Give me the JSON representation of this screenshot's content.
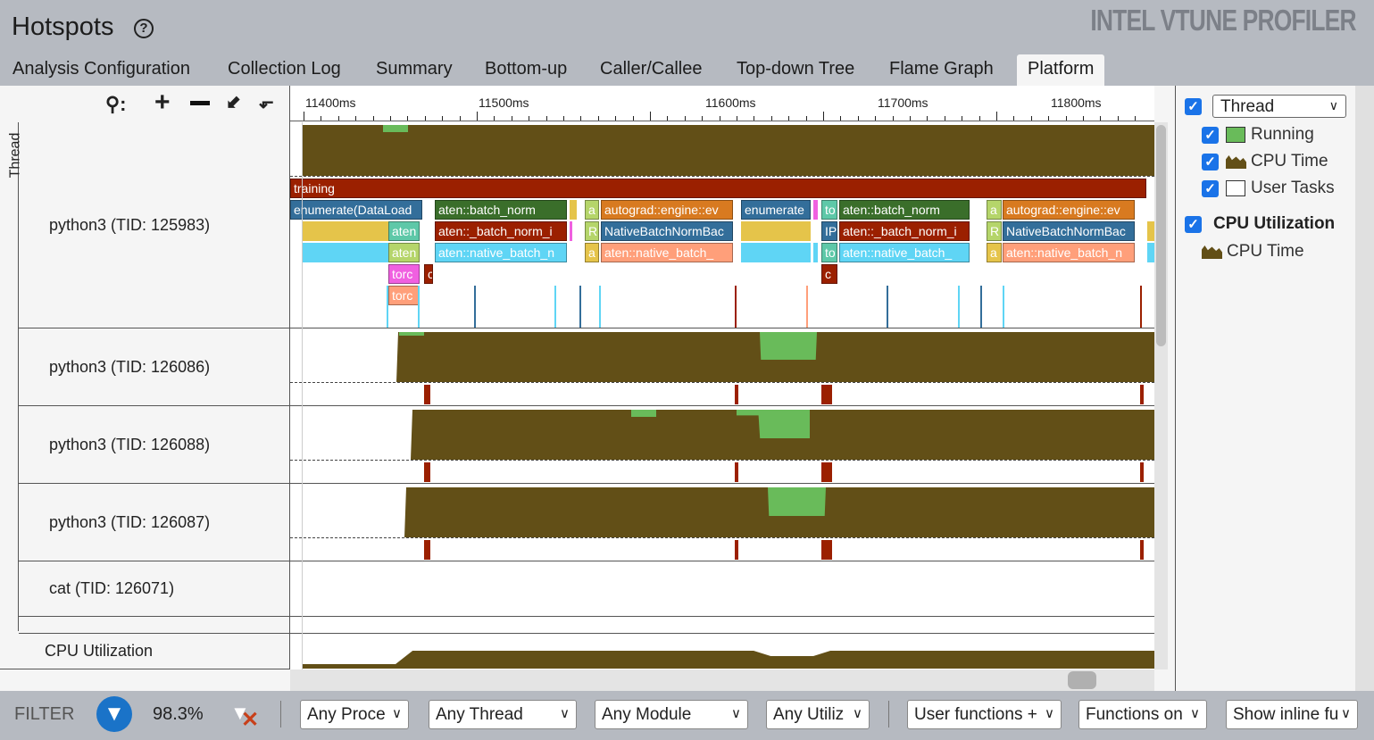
{
  "header": {
    "title": "Hotspots",
    "help_icon": "question-circle-icon",
    "brand": "INTEL VTUNE PROFILER"
  },
  "tabs": [
    {
      "label": "Analysis Configuration"
    },
    {
      "label": "Collection Log"
    },
    {
      "label": "Summary"
    },
    {
      "label": "Bottom-up"
    },
    {
      "label": "Caller/Callee"
    },
    {
      "label": "Top-down Tree"
    },
    {
      "label": "Flame Graph"
    },
    {
      "label": "Platform",
      "active": true
    }
  ],
  "timeline": {
    "ruler": [
      "11400ms",
      "11500ms",
      "11600ms",
      "11700ms",
      "11800ms"
    ],
    "side_label": "Thread",
    "rows": [
      "python3 (TID: 125983)",
      "python3 (TID: 126086)",
      "python3 (TID: 126088)",
      "python3 (TID: 126087)",
      "cat (TID: 126071)"
    ],
    "cpu_label": "CPU Utilization",
    "tasks": [
      "training",
      "enumerate(DataLoad",
      "aten::batch_norm",
      "a",
      "autograd::engine::ev",
      "enumerate",
      "to",
      "aten::batch_norm",
      "a",
      "autograd::engine::ev",
      "aten",
      "aten::_batch_norm_i",
      "R",
      "NativeBatchNormBac",
      "IP",
      "aten::_batch_norm_i",
      "R",
      "NativeBatchNormBac",
      "aten",
      "aten::native_batch_n",
      "a",
      "aten::native_batch_",
      "to",
      "aten::native_batch_",
      "a",
      "aten::native_batch_n",
      "torc",
      "c",
      "torc",
      "c"
    ]
  },
  "legend": {
    "thread_select": "Thread",
    "running": "Running",
    "cpu_time": "CPU Time",
    "user_tasks": "User Tasks",
    "cpu_util": "CPU Utilization",
    "cpu_time2": "CPU Time",
    "colors": {
      "running": "#69bb5a",
      "cpu_time": "#624f17",
      "task_dark_red": "#9b2000"
    }
  },
  "filter": {
    "label": "FILTER",
    "percent": "98.3%",
    "process": "Any Proce",
    "thread": "Any Thread",
    "module": "Any Module",
    "utilization": "Any Utiliz",
    "functions": "User functions +",
    "functions_on": "Functions on",
    "inline": "Show inline fu"
  }
}
